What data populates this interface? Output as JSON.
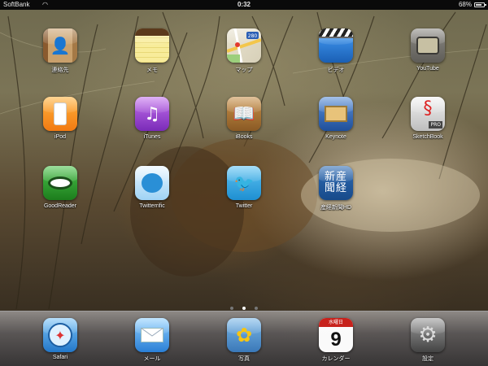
{
  "status_bar": {
    "carrier": "SoftBank",
    "time": "0:32",
    "battery": "68%"
  },
  "apps": [
    {
      "label": "連絡先",
      "icon": "contacts-icon"
    },
    {
      "label": "メモ",
      "icon": "notes-icon"
    },
    {
      "label": "マップ",
      "icon": "maps-icon",
      "icon_text": "280"
    },
    {
      "label": "ビデオ",
      "icon": "videos-icon"
    },
    {
      "label": "YouTube",
      "icon": "youtube-icon"
    },
    {
      "label": "iPod",
      "icon": "ipod-icon"
    },
    {
      "label": "iTunes",
      "icon": "itunes-icon"
    },
    {
      "label": "iBooks",
      "icon": "ibooks-icon"
    },
    {
      "label": "Keynote",
      "icon": "keynote-icon"
    },
    {
      "label": "SketchBook",
      "icon": "sketchbook-icon",
      "icon_text": "PRO"
    },
    {
      "label": "GoodReader",
      "icon": "goodreader-icon"
    },
    {
      "label": "Twitterrific",
      "icon": "twitterrific-icon"
    },
    {
      "label": "Twitter",
      "icon": "twitter-icon"
    },
    {
      "label": "産経新聞HD",
      "icon": "sankei-icon",
      "icon_text": "新産聞経"
    }
  ],
  "page_dots": {
    "count": 3,
    "active": 2
  },
  "dock": [
    {
      "label": "Safari",
      "icon": "safari-icon"
    },
    {
      "label": "メール",
      "icon": "mail-icon"
    },
    {
      "label": "写真",
      "icon": "photos-icon"
    },
    {
      "label": "カレンダー",
      "icon": "calendar-icon",
      "calendar_day_name": "水曜日",
      "calendar_date": "9"
    },
    {
      "label": "設定",
      "icon": "settings-icon"
    }
  ]
}
